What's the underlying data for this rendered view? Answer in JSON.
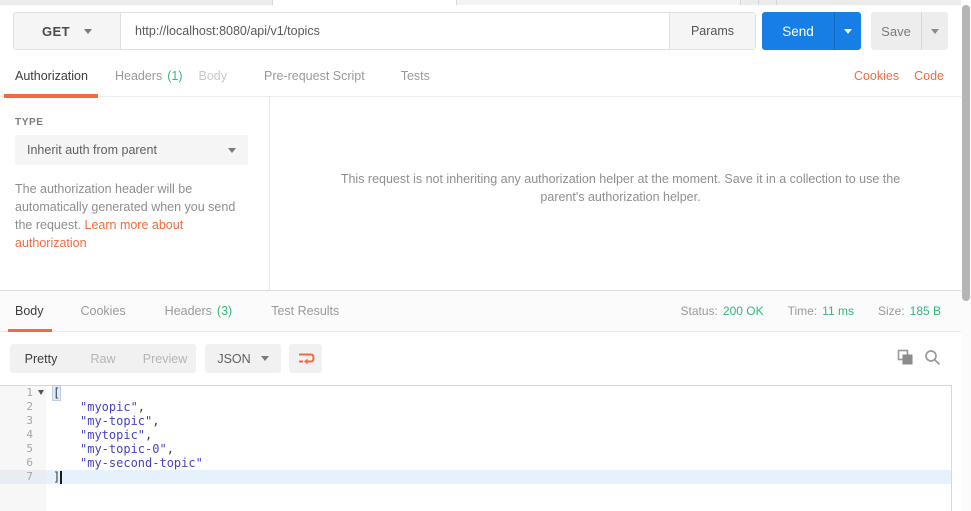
{
  "request_bar": {
    "method": "GET",
    "url": "http://localhost:8080/api/v1/topics",
    "params_label": "Params",
    "send_label": "Send",
    "save_label": "Save"
  },
  "request_tabs": {
    "authorization": "Authorization",
    "headers": "Headers",
    "headers_count": "(1)",
    "body": "Body",
    "prerequest": "Pre-request Script",
    "tests": "Tests",
    "cookies_link": "Cookies",
    "code_link": "Code"
  },
  "authorization": {
    "type_label": "TYPE",
    "type_value": "Inherit auth from parent",
    "description": "The authorization header will be automatically generated when you send the request. ",
    "link_text": "Learn more about authorization",
    "helper_message": "This request is not inheriting any authorization helper at the moment. Save it in a collection to use the parent's authorization helper."
  },
  "response": {
    "tabs": {
      "body": "Body",
      "cookies": "Cookies",
      "headers": "Headers",
      "headers_count": "(3)",
      "test_results": "Test Results"
    },
    "status": {
      "status_label": "Status:",
      "status_value": "200 OK",
      "time_label": "Time:",
      "time_value": "11 ms",
      "size_label": "Size:",
      "size_value": "185 B"
    },
    "toolbar": {
      "pretty": "Pretty",
      "raw": "Raw",
      "preview": "Preview",
      "format": "JSON"
    },
    "editor": {
      "lines": [
        {
          "num": "1",
          "code": "["
        },
        {
          "num": "2",
          "str": "\"myopic\"",
          "comma": ","
        },
        {
          "num": "3",
          "str": "\"my-topic\"",
          "comma": ","
        },
        {
          "num": "4",
          "str": "\"mytopic\"",
          "comma": ","
        },
        {
          "num": "5",
          "str": "\"my-topic-0\"",
          "comma": ","
        },
        {
          "num": "6",
          "str": "\"my-second-topic\"",
          "comma": ""
        },
        {
          "num": "7",
          "code": "]"
        }
      ]
    }
  },
  "icons": {
    "method_caret": "chevron-down",
    "send_caret": "chevron-down",
    "save_caret": "chevron-down",
    "type_caret": "chevron-down",
    "format_caret": "chevron-down",
    "fold_caret": "chevron-down",
    "wrap": "wrap-text",
    "copy": "copy",
    "search": "magnifier"
  },
  "colors": {
    "accent_orange": "#f26b3e",
    "primary_blue": "#177ee5",
    "success_green": "#34b77c",
    "json_string": "#4743c6"
  }
}
